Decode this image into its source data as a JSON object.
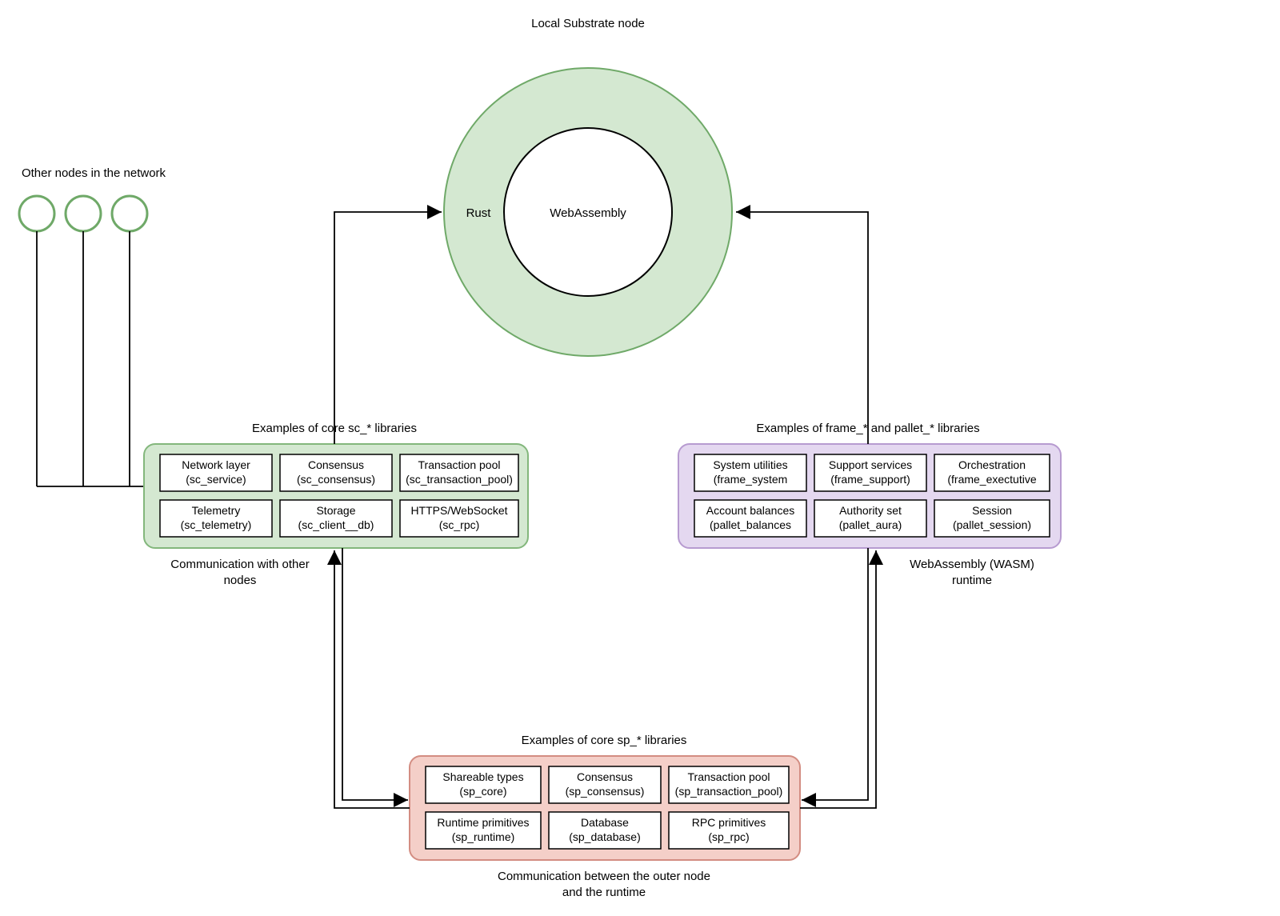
{
  "title": "Local Substrate node",
  "otherNodesLabel": "Other nodes in the network",
  "donut": {
    "outer": "Rust",
    "inner": "WebAssembly"
  },
  "scPanel": {
    "heading": "Examples of core sc_* libraries",
    "footer1": "Communication with other",
    "footer2": "nodes",
    "items": [
      {
        "l1": "Network layer",
        "l2": "(sc_service)"
      },
      {
        "l1": "Consensus",
        "l2": "(sc_consensus)"
      },
      {
        "l1": "Transaction pool",
        "l2": "(sc_transaction_pool)"
      },
      {
        "l1": "Telemetry",
        "l2": "(sc_telemetry)"
      },
      {
        "l1": "Storage",
        "l2": "(sc_client__db)"
      },
      {
        "l1": "HTTPS/WebSocket",
        "l2": "(sc_rpc)"
      }
    ]
  },
  "framePanel": {
    "heading": "Examples of frame_* and pallet_* libraries",
    "footer1": "WebAssembly (WASM)",
    "footer2": "runtime",
    "items": [
      {
        "l1": "System utilities",
        "l2": "(frame_system"
      },
      {
        "l1": "Support services",
        "l2": "(frame_support)"
      },
      {
        "l1": "Orchestration",
        "l2": "(frame_exectutive"
      },
      {
        "l1": "Account balances",
        "l2": "(pallet_balances"
      },
      {
        "l1": "Authority set",
        "l2": "(pallet_aura)"
      },
      {
        "l1": "Session",
        "l2": "(pallet_session)"
      }
    ]
  },
  "spPanel": {
    "heading": "Examples of core sp_* libraries",
    "footer1": "Communication between the outer node",
    "footer2": "and the runtime",
    "items": [
      {
        "l1": "Shareable types",
        "l2": "(sp_core)"
      },
      {
        "l1": "Consensus",
        "l2": "(sp_consensus)"
      },
      {
        "l1": "Transaction pool",
        "l2": "(sp_transaction_pool)"
      },
      {
        "l1": "Runtime primitives",
        "l2": "(sp_runtime)"
      },
      {
        "l1": "Database",
        "l2": "(sp_database)"
      },
      {
        "l1": "RPC primitives",
        "l2": "(sp_rpc)"
      }
    ]
  }
}
